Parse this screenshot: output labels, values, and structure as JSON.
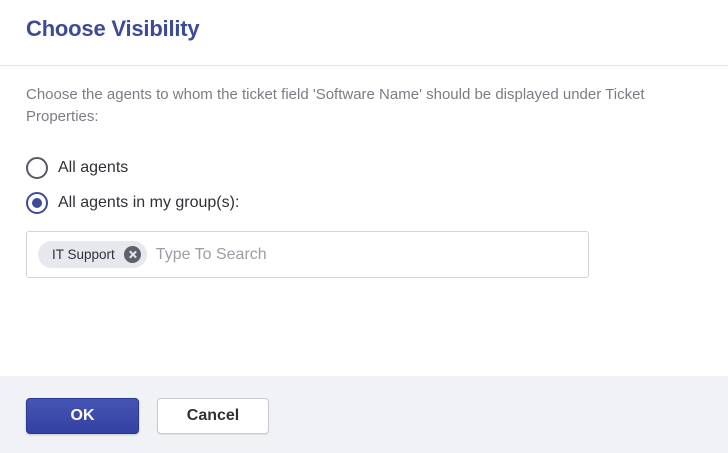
{
  "dialog": {
    "title": "Choose Visibility",
    "description": "Choose the agents to whom the ticket field 'Software Name' should be displayed under Ticket Properties:"
  },
  "visibility_options": [
    {
      "label": "All agents",
      "selected": false
    },
    {
      "label": "All agents in my group(s):",
      "selected": true
    }
  ],
  "group_search": {
    "chips": [
      {
        "label": "IT Support"
      }
    ],
    "value": "",
    "placeholder": "Type To Search"
  },
  "footer": {
    "ok_label": "OK",
    "cancel_label": "Cancel"
  },
  "colors": {
    "accent": "#3c4a9a",
    "footer_bg": "#f1f2f6"
  }
}
